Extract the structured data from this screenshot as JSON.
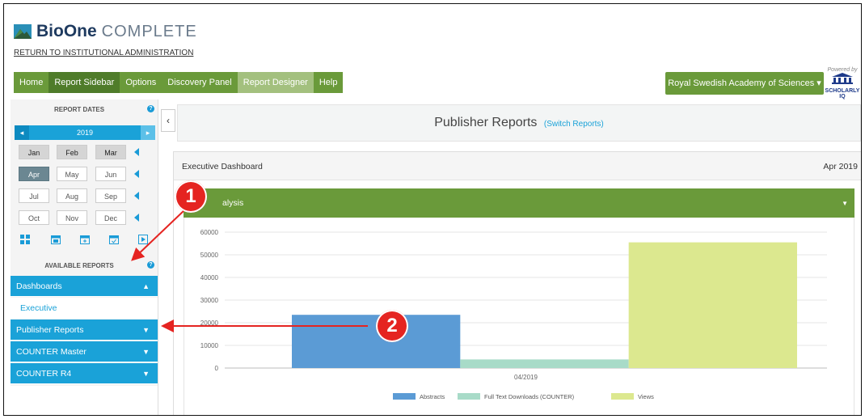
{
  "brand": {
    "name_bold": "BioOne",
    "name_light": "COMPLETE"
  },
  "return_link": "RETURN TO INSTITUTIONAL ADMINISTRATION",
  "nav": [
    "Home",
    "Report Sidebar",
    "Options",
    "Discovery Panel",
    "Report Designer",
    "Help"
  ],
  "institution": "Royal Swedish Academy of Sciences ▾",
  "powered": {
    "by": "Powered by",
    "name": "SCHOLARLY IQ"
  },
  "sidebar": {
    "report_dates": "REPORT DATES",
    "year": "2019",
    "months": [
      "Jan",
      "Feb",
      "Mar",
      "Apr",
      "May",
      "Jun",
      "Jul",
      "Aug",
      "Sep",
      "Oct",
      "Nov",
      "Dec"
    ],
    "available_reports": "AVAILABLE REPORTS",
    "sections": {
      "dashboards": "Dashboards",
      "executive": "Executive",
      "publisher_reports": "Publisher Reports",
      "counter_master": "COUNTER Master",
      "counter_r4": "COUNTER R4"
    }
  },
  "main": {
    "title": "Publisher Reports",
    "switch": "(Switch Reports)",
    "panel_title": "Executive Dashboard",
    "panel_date": "Apr 2019",
    "section_title": "alysis"
  },
  "callouts": [
    "1",
    "2"
  ],
  "colors": {
    "green": "#6a9a3a",
    "blue": "#1aa2d8",
    "red": "#e52421"
  },
  "chart_data": {
    "type": "bar",
    "categories": [
      "04/2019"
    ],
    "series": [
      {
        "name": "Abstracts",
        "values": [
          23500
        ],
        "color": "#5b9bd5"
      },
      {
        "name": "Full Text Downloads (COUNTER)",
        "values": [
          3800
        ],
        "color": "#a8dbc8"
      },
      {
        "name": "Views",
        "values": [
          55500
        ],
        "color": "#dce88f"
      }
    ],
    "y_ticks": [
      "0",
      "10000",
      "20000",
      "30000",
      "40000",
      "50000",
      "60000"
    ],
    "ylim": [
      0,
      60000
    ],
    "grid": true,
    "legend": "bottom"
  }
}
